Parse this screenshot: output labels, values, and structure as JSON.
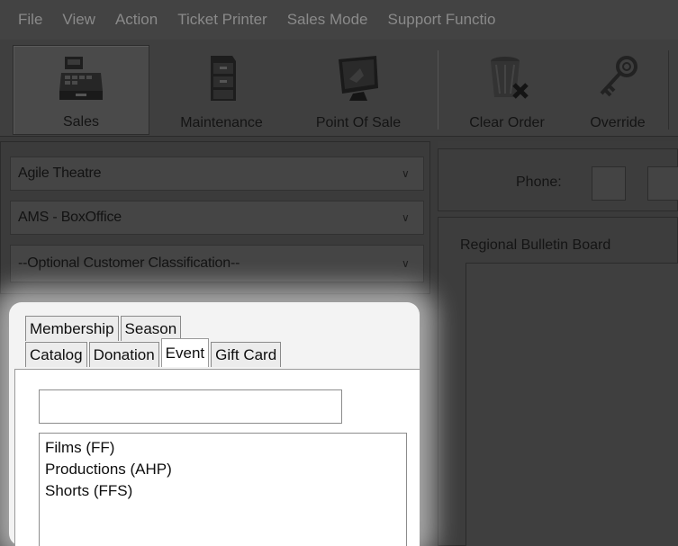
{
  "menu": {
    "items": [
      "File",
      "View",
      "Action",
      "Ticket Printer",
      "Sales Mode",
      "Support Functio"
    ]
  },
  "toolbar": {
    "buttons": [
      {
        "label": "Sales",
        "icon": "cash-register-icon"
      },
      {
        "label": "Maintenance",
        "icon": "file-cabinet-icon"
      },
      {
        "label": "Point Of Sale",
        "icon": "monitor-icon"
      },
      {
        "label": "Clear Order",
        "icon": "trash-can-icon"
      },
      {
        "label": "Override",
        "icon": "key-icon"
      }
    ]
  },
  "selectors": {
    "organization": "Agile Theatre",
    "location": "AMS - BoxOffice",
    "customer_classification": "--Optional Customer Classification--"
  },
  "customer": {
    "phone_label": "Phone:"
  },
  "bulletin": {
    "title": "Regional Bulletin Board"
  },
  "tabs": {
    "row1": [
      "Membership",
      "Season"
    ],
    "row2": [
      "Catalog",
      "Donation",
      "Event",
      "Gift Card"
    ],
    "active": "Event"
  },
  "event_list": {
    "search_value": "",
    "items": [
      "Films  (FF)",
      "Productions  (AHP)",
      "Shorts  (FFS)"
    ]
  }
}
